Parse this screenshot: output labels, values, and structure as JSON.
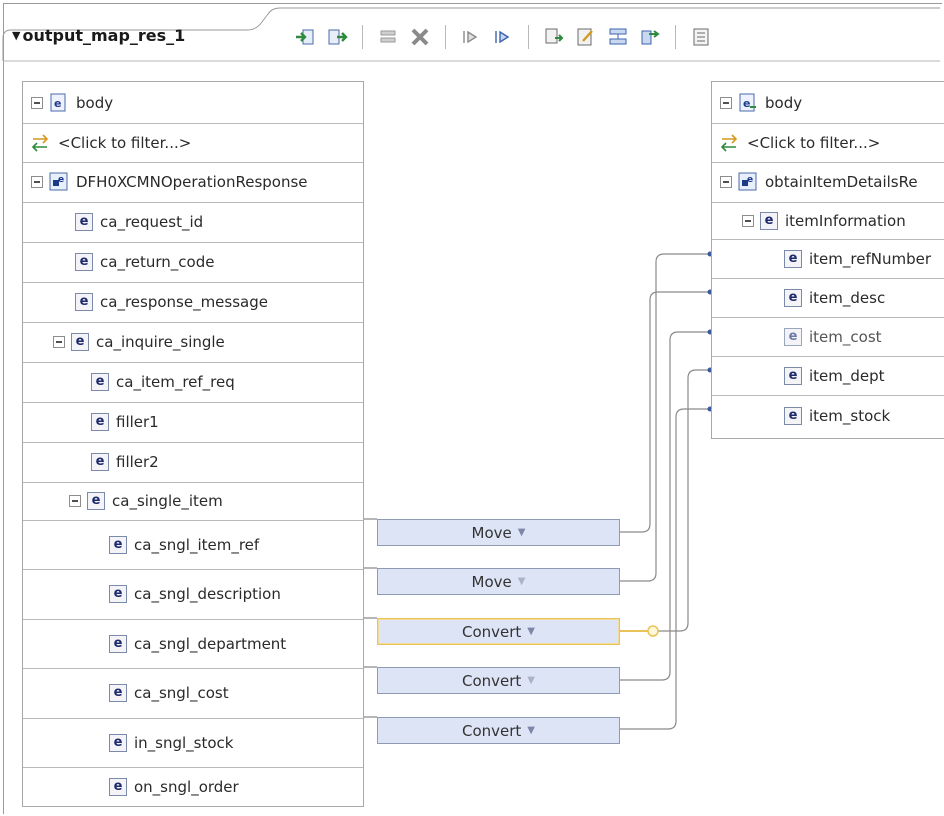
{
  "tab": {
    "title": "output_map_res_1"
  },
  "toolbar": {
    "icons": [
      "add-input-icon",
      "add-output-icon",
      "delete-transform-icon",
      "delete-icon",
      "move-next-icon",
      "move-previous-icon",
      "map-icon",
      "edit-icon",
      "align-icon",
      "auto-map-icon",
      "properties-icon"
    ]
  },
  "left_tree": {
    "root": "body",
    "filter": "<Click to filter...>",
    "rows": [
      "DFH0XCMNOperationResponse",
      "ca_request_id",
      "ca_return_code",
      "ca_response_message",
      "ca_inquire_single",
      "ca_item_ref_req",
      "filler1",
      "filler2",
      "ca_single_item",
      "ca_sngl_item_ref",
      "ca_sngl_description",
      "ca_sngl_department",
      "ca_sngl_cost",
      "in_sngl_stock",
      "on_sngl_order"
    ]
  },
  "right_tree": {
    "root": "body",
    "filter": "<Click to filter...>",
    "rows": [
      "obtainItemDetailsRe",
      "itemInformation",
      "item_refNumber",
      "item_desc",
      "item_cost",
      "item_dept",
      "item_stock"
    ]
  },
  "transforms": [
    {
      "label": "Move"
    },
    {
      "label": "Move"
    },
    {
      "label": "Convert"
    },
    {
      "label": "Convert"
    },
    {
      "label": "Convert"
    }
  ],
  "element_glyph": "e",
  "colors": {
    "transform_fill": "#dde4f6",
    "selected_border": "#e9c25a",
    "wire": "#8a8a8a"
  }
}
